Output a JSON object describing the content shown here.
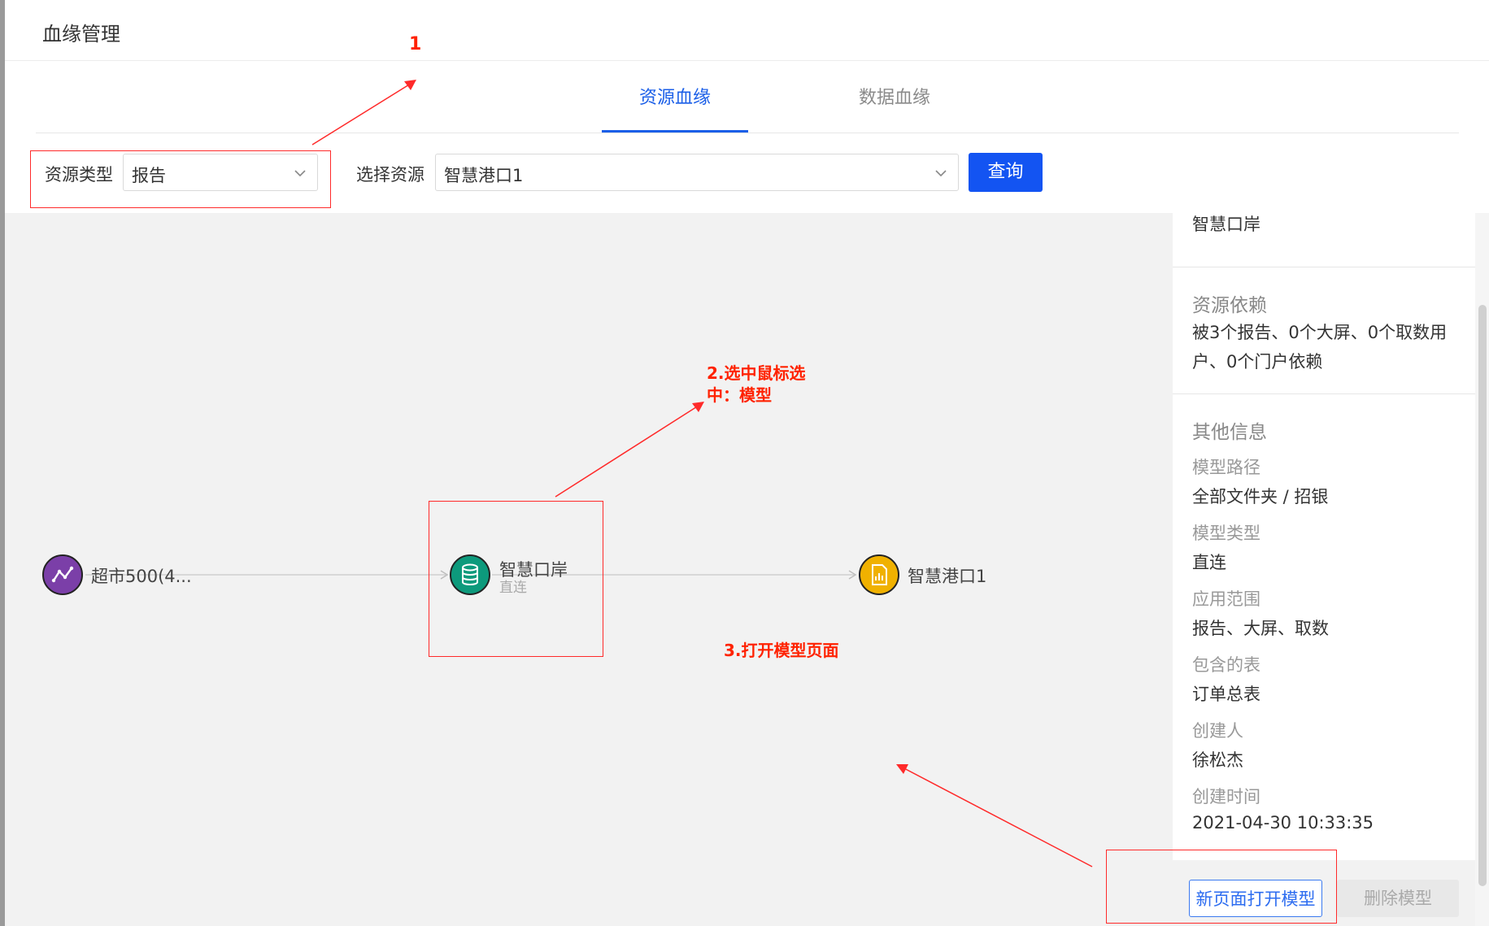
{
  "header": {
    "title": "血缘管理"
  },
  "tabs": [
    {
      "label": "资源血缘",
      "active": true
    },
    {
      "label": "数据血缘",
      "active": false
    }
  ],
  "filters": {
    "resource_type_label": "资源类型",
    "resource_type_value": "报告",
    "select_resource_label": "选择资源",
    "select_resource_value": "智慧港口1",
    "query_label": "查询"
  },
  "graph": {
    "nodes": [
      {
        "label": "超市500(4...",
        "icon": "line-chart-icon",
        "color": "#7b3fa8"
      },
      {
        "label": "智慧口岸",
        "sub": "直连",
        "icon": "database-icon",
        "color": "#0d9a7c"
      },
      {
        "label": "智慧港口1",
        "icon": "report-icon",
        "color": "#f0b100"
      }
    ]
  },
  "panel": {
    "top_value": "智慧口岸",
    "dependency_title": "资源依赖",
    "dependency_line1": "被3个报告、0个大屏、0个取数用",
    "dependency_line2": "户、0个门户依赖",
    "other_title": "其他信息",
    "fields": [
      {
        "key": "模型路径",
        "value": "全部文件夹 / 招银"
      },
      {
        "key": "模型类型",
        "value": "直连"
      },
      {
        "key": "应用范围",
        "value": "报告、大屏、取数"
      },
      {
        "key": "包含的表",
        "value": "订单总表"
      },
      {
        "key": "创建人",
        "value": "徐松杰"
      },
      {
        "key": "创建时间",
        "value": "2021-04-30 10:33:35"
      }
    ],
    "open_button": "新页面打开模型",
    "delete_button": "删除模型"
  },
  "annotations": {
    "a1": "1",
    "a2_line1": "2.选中鼠标选",
    "a2_line2": "中：模型",
    "a3": "3.打开模型页面",
    "color": "#ff2200"
  }
}
